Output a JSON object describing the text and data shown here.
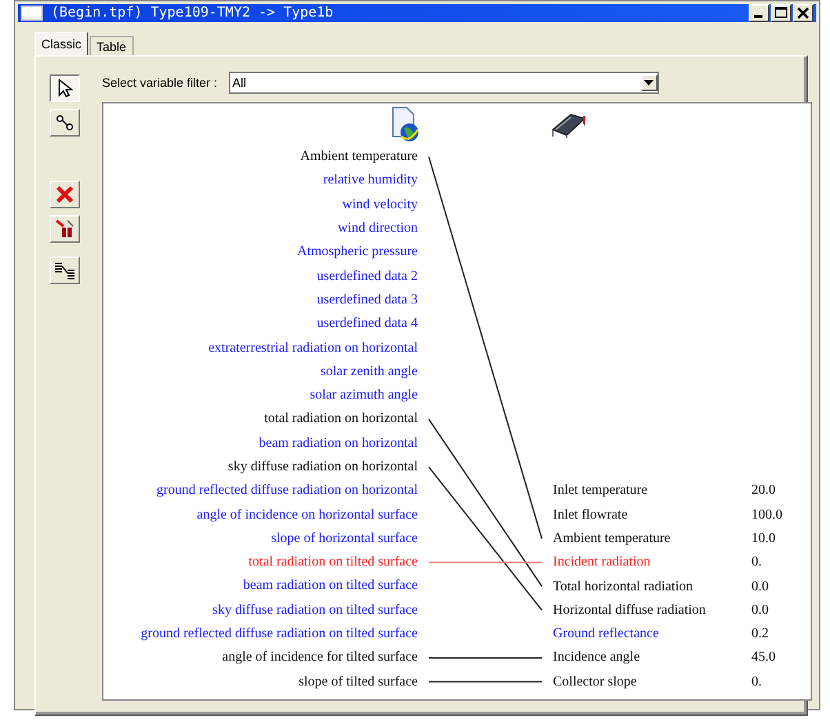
{
  "window": {
    "title": "(Begin.tpf) Type109-TMY2 -> Type1b"
  },
  "tabs": [
    {
      "label": "Classic",
      "selected": true
    },
    {
      "label": "Table",
      "selected": false
    }
  ],
  "filter": {
    "label": "Select variable filter :",
    "value": "All"
  },
  "toolbar": [
    {
      "kind": "pointer",
      "selected": true
    },
    {
      "kind": "link",
      "selected": false
    },
    {
      "kind": "delete",
      "selected": false
    },
    {
      "kind": "delete-all",
      "selected": false
    },
    {
      "kind": "auto",
      "selected": false
    }
  ],
  "outputs": [
    {
      "name": "Ambient temperature",
      "kind": "connected"
    },
    {
      "name": "relative humidity",
      "kind": "free"
    },
    {
      "name": "wind velocity",
      "kind": "free"
    },
    {
      "name": "wind direction",
      "kind": "free"
    },
    {
      "name": "Atmospheric pressure",
      "kind": "free"
    },
    {
      "name": "userdefined data 2",
      "kind": "free"
    },
    {
      "name": "userdefined data 3",
      "kind": "free"
    },
    {
      "name": "userdefined data 4",
      "kind": "free"
    },
    {
      "name": "extraterrestrial radiation on horizontal",
      "kind": "free"
    },
    {
      "name": "solar zenith angle",
      "kind": "free"
    },
    {
      "name": "solar azimuth angle",
      "kind": "free"
    },
    {
      "name": "total radiation on horizontal",
      "kind": "connected"
    },
    {
      "name": "beam radiation on horizontal",
      "kind": "free"
    },
    {
      "name": "sky diffuse radiation on horizontal",
      "kind": "connected"
    },
    {
      "name": "ground reflected diffuse radiation on horizontal",
      "kind": "free"
    },
    {
      "name": "angle of incidence on horizontal surface",
      "kind": "free"
    },
    {
      "name": "slope of horizontal surface",
      "kind": "free"
    },
    {
      "name": "total radiation on tilted surface",
      "kind": "selected"
    },
    {
      "name": "beam radiation on tilted surface",
      "kind": "free"
    },
    {
      "name": "sky diffuse radiation on tilted surface",
      "kind": "free"
    },
    {
      "name": "ground reflected diffuse radiation on tilted surface",
      "kind": "free"
    },
    {
      "name": "angle of incidence for tilted surface",
      "kind": "connected"
    },
    {
      "name": "slope of tilted surface",
      "kind": "connected"
    }
  ],
  "inputs": [
    {
      "name": "Inlet temperature",
      "value": "20.0",
      "kind": "set"
    },
    {
      "name": "Inlet flowrate",
      "value": "100.0",
      "kind": "set"
    },
    {
      "name": "Ambient temperature",
      "value": "10.0",
      "kind": "connected"
    },
    {
      "name": "Incident radiation",
      "value": "0.",
      "kind": "selected"
    },
    {
      "name": "Total horizontal radiation",
      "value": "0.0",
      "kind": "connected"
    },
    {
      "name": "Horizontal diffuse radiation",
      "value": "0.0",
      "kind": "connected"
    },
    {
      "name": "Ground reflectance",
      "value": "0.2",
      "kind": "free"
    },
    {
      "name": "Incidence angle",
      "value": "45.0",
      "kind": "connected"
    },
    {
      "name": "Collector slope",
      "value": "0.",
      "kind": "connected"
    }
  ]
}
